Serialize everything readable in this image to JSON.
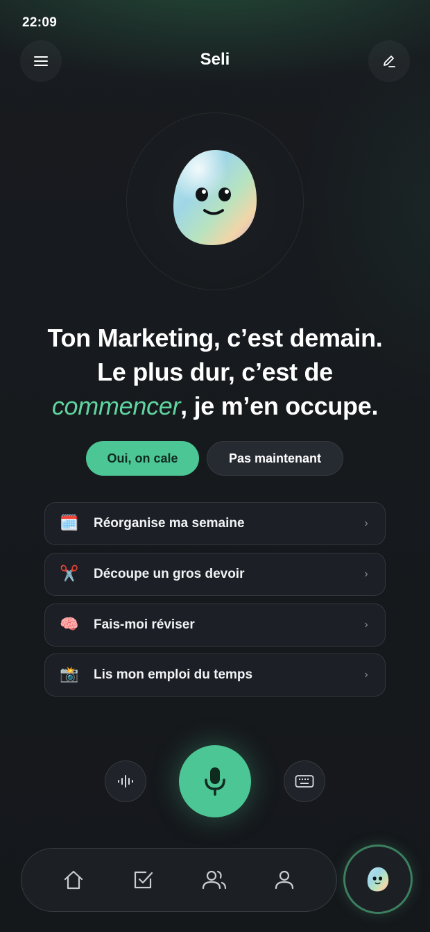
{
  "status_bar": {
    "time": "22:09"
  },
  "header": {
    "title": "Seli",
    "menu_icon": "hamburger-menu-icon",
    "edit_icon": "pencil-edit-icon"
  },
  "hero": {
    "line1": "Ton Marketing, c’est demain.",
    "line2": "Le plus dur, c’est de",
    "accent_word": "commencer",
    "line3_rest": ", je m’en occupe."
  },
  "actions": {
    "accept_label": "Oui, on cale",
    "decline_label": "Pas maintenant"
  },
  "suggestions": [
    {
      "emoji": "🗓️",
      "icon": "calendar-icon",
      "label": "Réorganise ma semaine"
    },
    {
      "emoji": "✂️",
      "icon": "scissors-icon",
      "label": "Découpe un gros devoir"
    },
    {
      "emoji": "🧠",
      "icon": "brain-icon",
      "label": "Fais-moi réviser"
    },
    {
      "emoji": "📸",
      "icon": "camera-icon",
      "label": "Lis mon emploi du temps"
    }
  ],
  "input_controls": {
    "voice_wave_icon": "audio-waveform-icon",
    "mic_icon": "microphone-icon",
    "keyboard_icon": "keyboard-icon"
  },
  "bottom_nav": {
    "items": [
      "home-icon",
      "checkbox-icon",
      "users-icon",
      "user-icon"
    ],
    "assistant_icon": "seli-mascot-icon"
  },
  "colors": {
    "accent": "#4cc695",
    "accent_text": "#5fd4a0",
    "background": "#16191d",
    "card": "#1c2026"
  }
}
